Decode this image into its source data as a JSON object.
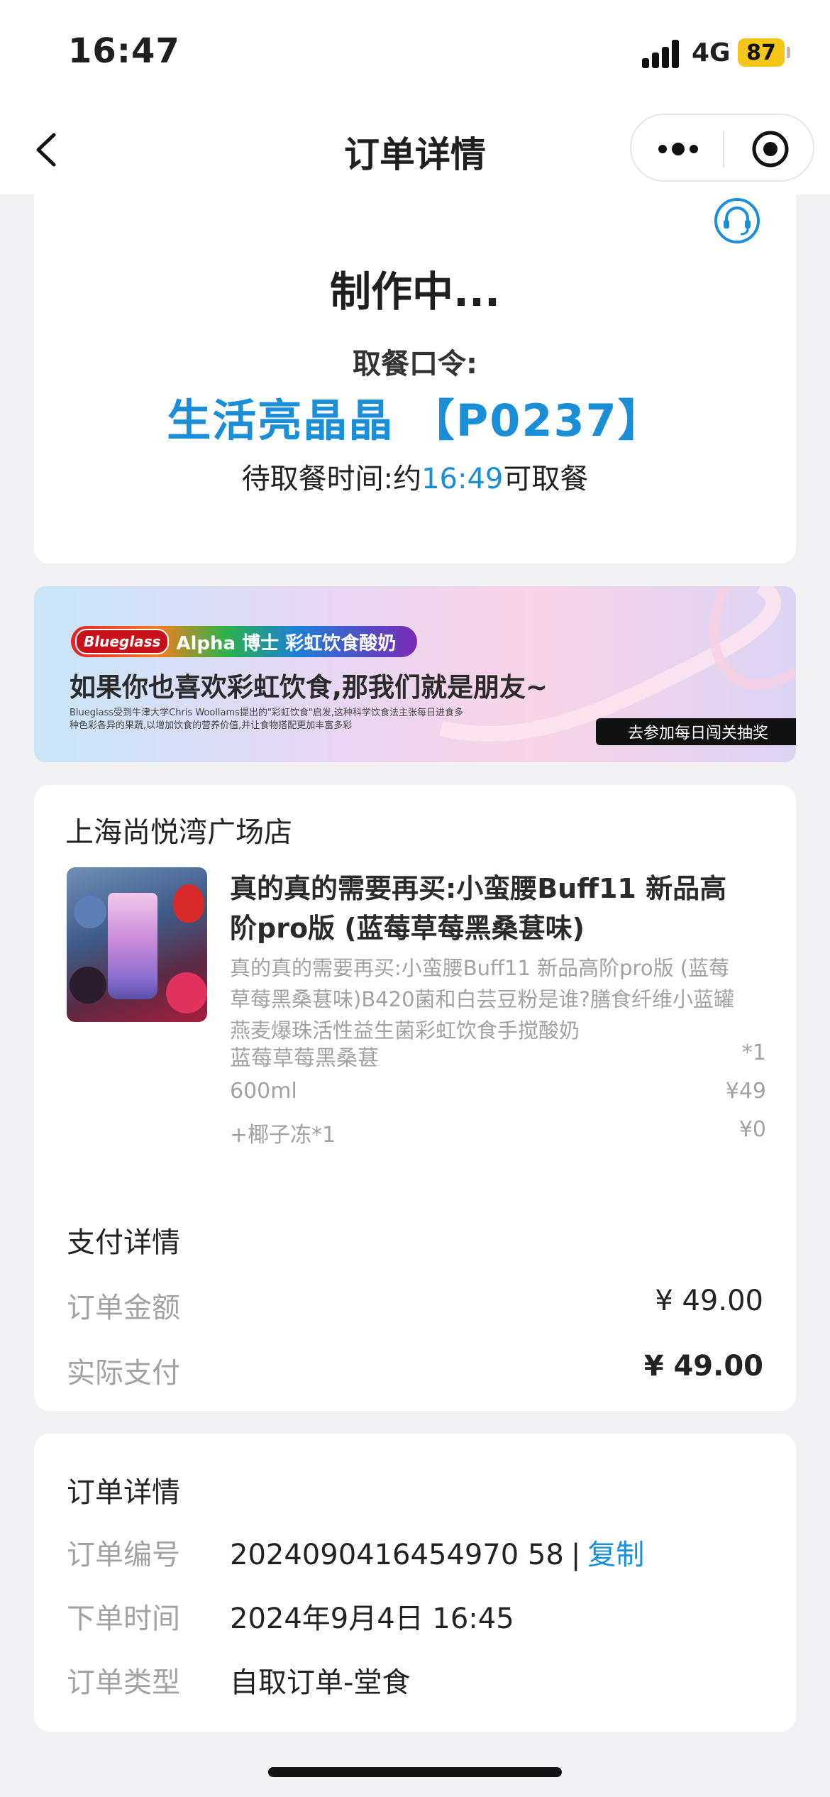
{
  "status_bar": {
    "time": "16:47",
    "network": "4G",
    "battery": "87"
  },
  "nav": {
    "title": "订单详情",
    "back_icon": "chevron-left-icon",
    "more_icon": "more-dots-icon",
    "close_icon": "target-circle-icon"
  },
  "order_status": {
    "state": "制作中...",
    "code_label": "取餐口令:",
    "code_value": "生活亮晶晶 【P0237】",
    "wait_prefix": "待取餐时间:约",
    "wait_time": "16:49",
    "wait_suffix": "可取餐",
    "support_icon": "headset-icon"
  },
  "banner": {
    "brand": "Blueglass",
    "tag": "Alpha 博士 彩虹饮食酸奶",
    "headline": "如果你也喜欢彩虹饮食,那我们就是朋友~",
    "small_text": "Blueglass受到牛津大学Chris Woollams提出的\"彩虹饮食\"启发,这种科学饮食法主张每日进食多种色彩各异的果蔬,以增加饮食的营养价值,并让食物搭配更加丰富多彩",
    "cta": "去参加每日闯关抽奖"
  },
  "order": {
    "store": "上海尚悦湾广场店",
    "product_name": "真的真的需要再买:小蛮腰Buff11 新品高阶pro版 (蓝莓草莓黑桑葚味)",
    "product_desc": "真的真的需要再买:小蛮腰Buff11 新品高阶pro版 (蓝莓草莓黑桑葚味)B420菌和白芸豆粉是谁?膳食纤维小蓝罐燕麦爆珠活性益生菌彩虹饮食手搅酸奶",
    "specs": [
      {
        "left": "蓝莓草莓黑桑葚",
        "right": "*1"
      },
      {
        "left": "600ml",
        "right": "¥49"
      },
      {
        "left": "+椰子冻*1",
        "right": "¥0"
      }
    ]
  },
  "payment": {
    "title": "支付详情",
    "rows": [
      {
        "label": "订单金额",
        "value": "¥ 49.00"
      },
      {
        "label": "实际支付",
        "value": "¥ 49.00"
      }
    ]
  },
  "details": {
    "title": "订单详情",
    "order_no_label": "订单编号",
    "order_no": "2024090416454970 58",
    "copy": "复制",
    "time_label": "下单时间",
    "time": "2024年9月4日 16:45",
    "type_label": "订单类型",
    "type": "自取订单-堂食"
  },
  "colors": {
    "accent": "#1a8ed6",
    "battery": "#f5c518"
  }
}
